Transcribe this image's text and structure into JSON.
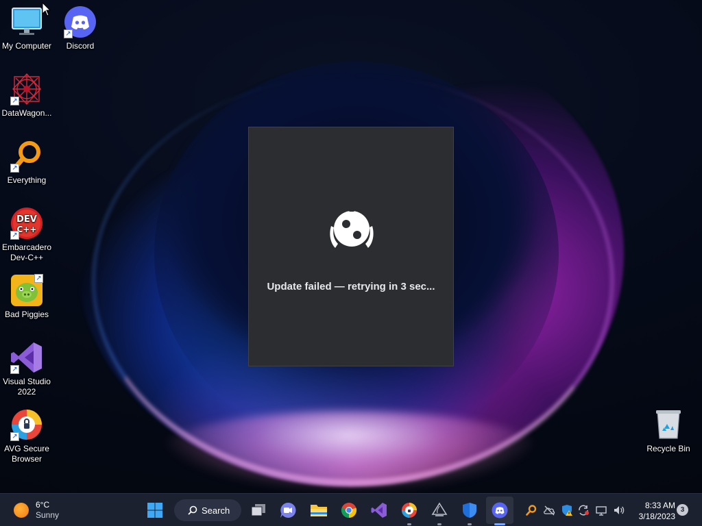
{
  "desktop": {
    "icons": [
      {
        "label": "My Computer",
        "icon": "monitor-icon"
      },
      {
        "label": "Discord",
        "icon": "discord-icon"
      },
      {
        "label": "DataWagon...",
        "icon": "datawagon-icon"
      },
      {
        "label": "Everything",
        "icon": "everything-search-icon"
      },
      {
        "label": "Embarcadero Dev-C++",
        "icon": "devcpp-icon",
        "icon_text": "DEV C++"
      },
      {
        "label": "Bad Piggies",
        "icon": "bad-piggies-icon"
      },
      {
        "label": "Visual Studio 2022",
        "icon": "visual-studio-icon"
      },
      {
        "label": "AVG Secure Browser",
        "icon": "avg-browser-icon"
      },
      {
        "label": "Recycle Bin",
        "icon": "recycle-bin-icon"
      }
    ]
  },
  "dialog": {
    "message": "Update failed — retrying in 3 sec...",
    "icon": "discord-updater-logo"
  },
  "taskbar": {
    "weather": {
      "temp": "6°C",
      "condition": "Sunny",
      "icon": "sun-icon"
    },
    "search_label": "Search",
    "apps": [
      {
        "name": "start",
        "icon": "windows-start-icon"
      },
      {
        "name": "task-view",
        "icon": "task-view-icon"
      },
      {
        "name": "teams-chat",
        "icon": "teams-icon"
      },
      {
        "name": "file-explorer",
        "icon": "folder-icon"
      },
      {
        "name": "chrome",
        "icon": "chrome-icon"
      },
      {
        "name": "visual-studio",
        "icon": "visual-studio-icon"
      },
      {
        "name": "avg-browser",
        "icon": "avg-browser-icon"
      },
      {
        "name": "inkscape",
        "icon": "inkscape-icon"
      },
      {
        "name": "windows-security",
        "icon": "shield-icon"
      },
      {
        "name": "discord",
        "icon": "discord-icon",
        "active": true
      }
    ],
    "tray_icons": [
      "everything-tray-icon",
      "onedrive-icon",
      "security-warning-icon",
      "sync-icon",
      "network-icon",
      "volume-icon"
    ],
    "clock": {
      "time": "8:33 AM",
      "date": "3/18/2023"
    },
    "notification_count": "3"
  },
  "colors": {
    "dialog_bg": "#2b2d31",
    "taskbar_bg": "#1c2130",
    "discord_blurple": "#5865f2"
  }
}
